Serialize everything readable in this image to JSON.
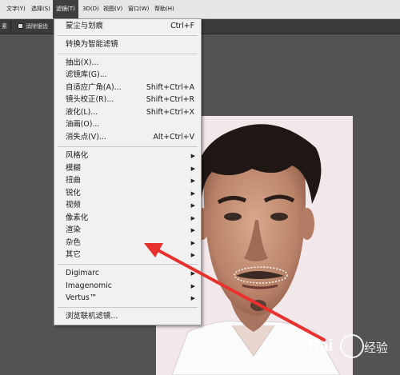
{
  "menubar": {
    "items": [
      "文字(Y)",
      "选择(S)",
      "滤镜(T)",
      "3D(D)",
      "视图(V)",
      "窗口(W)",
      "帮助(H)"
    ]
  },
  "options_bar": {
    "left_text": "素",
    "checkbox_label": "消除锯齿"
  },
  "filter_menu": {
    "items": [
      {
        "label": "蒙尘与划痕",
        "shortcut": "Ctrl+F"
      },
      {
        "label": "转换为智能滤镜"
      },
      {
        "label": "抽出(X)..."
      },
      {
        "label": "滤镜库(G)..."
      },
      {
        "label": "自适应广角(A)...",
        "shortcut": "Shift+Ctrl+A"
      },
      {
        "label": "镜头校正(R)...",
        "shortcut": "Shift+Ctrl+R"
      },
      {
        "label": "液化(L)...",
        "shortcut": "Shift+Ctrl+X"
      },
      {
        "label": "油画(O)..."
      },
      {
        "label": "消失点(V)...",
        "shortcut": "Alt+Ctrl+V"
      },
      {
        "label": "风格化"
      },
      {
        "label": "模糊"
      },
      {
        "label": "扭曲"
      },
      {
        "label": "锐化"
      },
      {
        "label": "视频"
      },
      {
        "label": "像素化"
      },
      {
        "label": "渲染"
      },
      {
        "label": "杂色"
      },
      {
        "label": "其它"
      },
      {
        "label": "Digimarc"
      },
      {
        "label": "Imagenomic"
      },
      {
        "label": "Vertus™"
      },
      {
        "label": "浏览联机滤镜..."
      }
    ]
  },
  "watermark": {
    "text": "Bai",
    "text2": "经验"
  },
  "colors": {
    "menubar_bg": "#e6e6e6",
    "menu_bg": "#f1f1f1",
    "canvas_bg": "#535353",
    "arrow": "#e8312f"
  }
}
